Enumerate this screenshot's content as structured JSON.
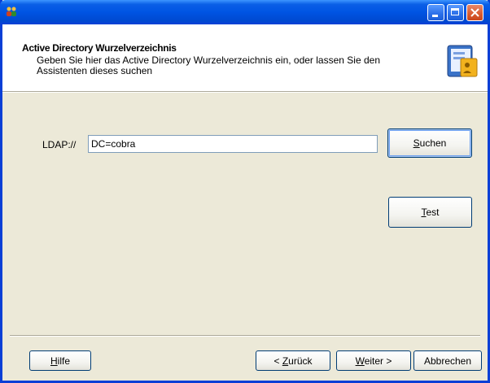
{
  "window": {
    "title": "",
    "icon": "app-users-icon"
  },
  "header": {
    "title": "Active Directory Wurzelverzeichnis",
    "subtitle": "Geben Sie hier das Active Directory Wurzelverzeichnis ein, oder lassen Sie den Assistenten dieses suchen",
    "icon": "directory-book-icon"
  },
  "form": {
    "ldap_label": "LDAP://",
    "ldap_value": "DC=cobra",
    "search_button": {
      "accel": "S",
      "rest": "uchen"
    },
    "test_button": {
      "accel": "T",
      "rest": "est"
    }
  },
  "footer": {
    "help_button": {
      "pre": "",
      "accel": "H",
      "rest": "ilfe"
    },
    "back_button": {
      "pre": "< ",
      "accel": "Z",
      "rest": "urück"
    },
    "next_button": {
      "pre": "",
      "accel": "W",
      "rest": "eiter >"
    },
    "cancel_button": "Abbrechen"
  }
}
